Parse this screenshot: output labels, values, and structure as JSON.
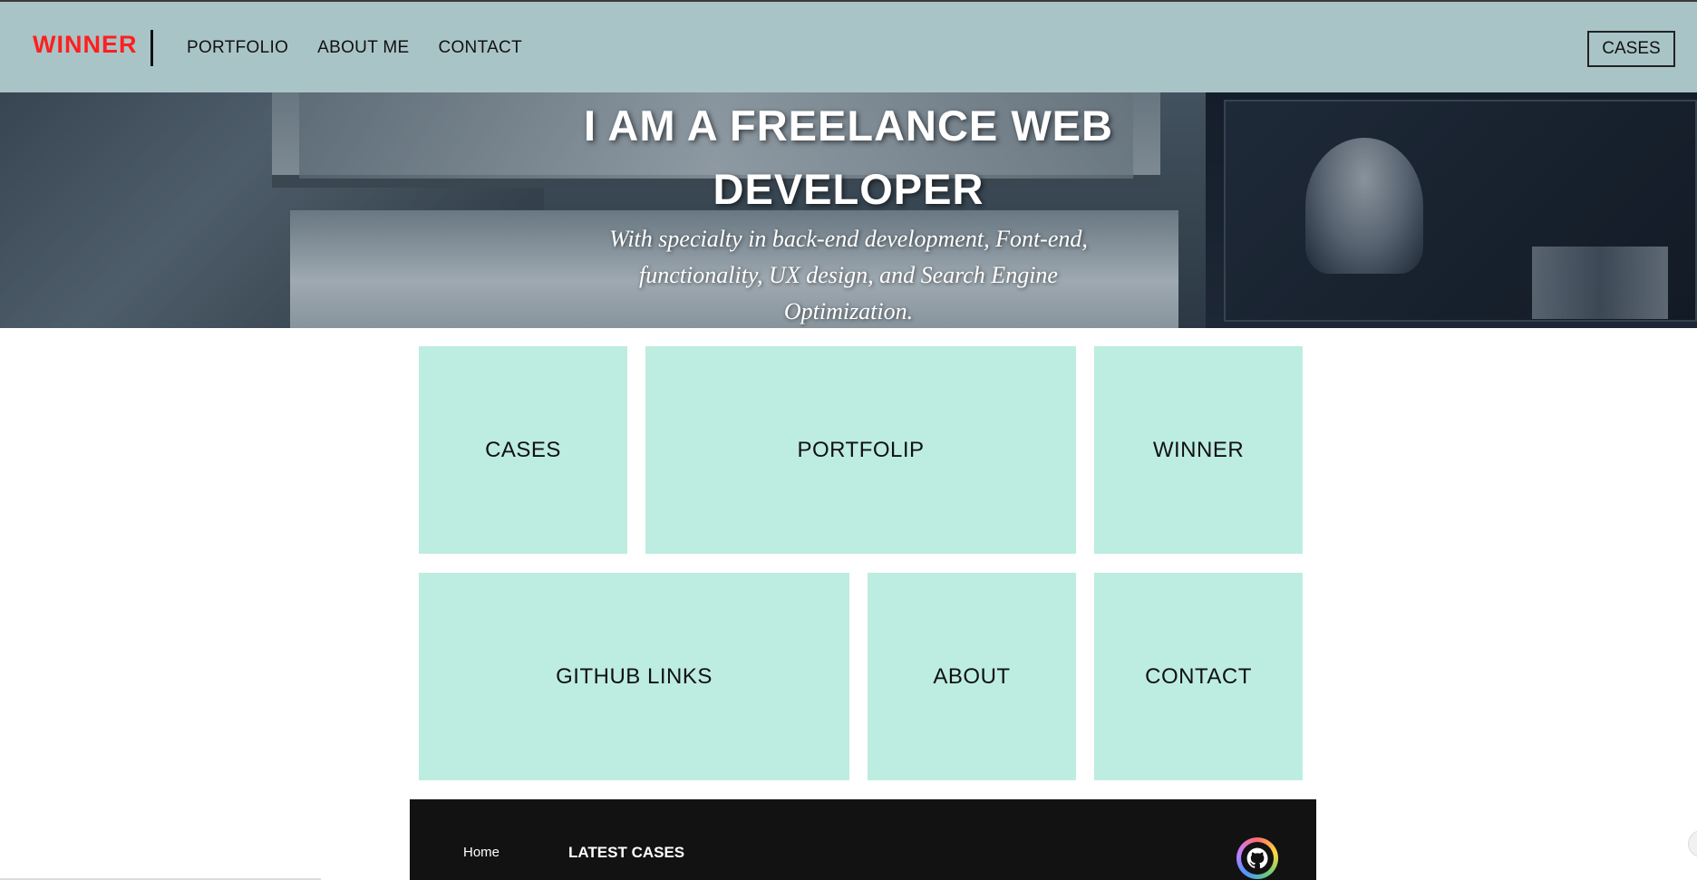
{
  "header": {
    "logo": "WINNER",
    "nav": [
      "PORTFOLIO",
      "ABOUT ME",
      "CONTACT"
    ],
    "cta_label": "CASES"
  },
  "hero": {
    "title_line1": "I AM A FREELANCE WEB",
    "title_line2": "DEVELOPER",
    "subtitle": "With specialty in back-end development, Font-end, functionality, UX design, and Search Engine Optimization."
  },
  "tiles": {
    "cases": "CASES",
    "portfolio": "PORTFOLIP",
    "winner": "WINNER",
    "github": "GITHUB LINKS",
    "about": "ABOUT",
    "contact": "CONTACT"
  },
  "footer": {
    "home": "Home",
    "latest": "LATEST CASES",
    "github_icon": "github-icon"
  },
  "colors": {
    "header_bg": "#a9c4c7",
    "logo": "#ff1f1f",
    "tile_bg": "#bdede0",
    "footer_bg": "#121212"
  }
}
